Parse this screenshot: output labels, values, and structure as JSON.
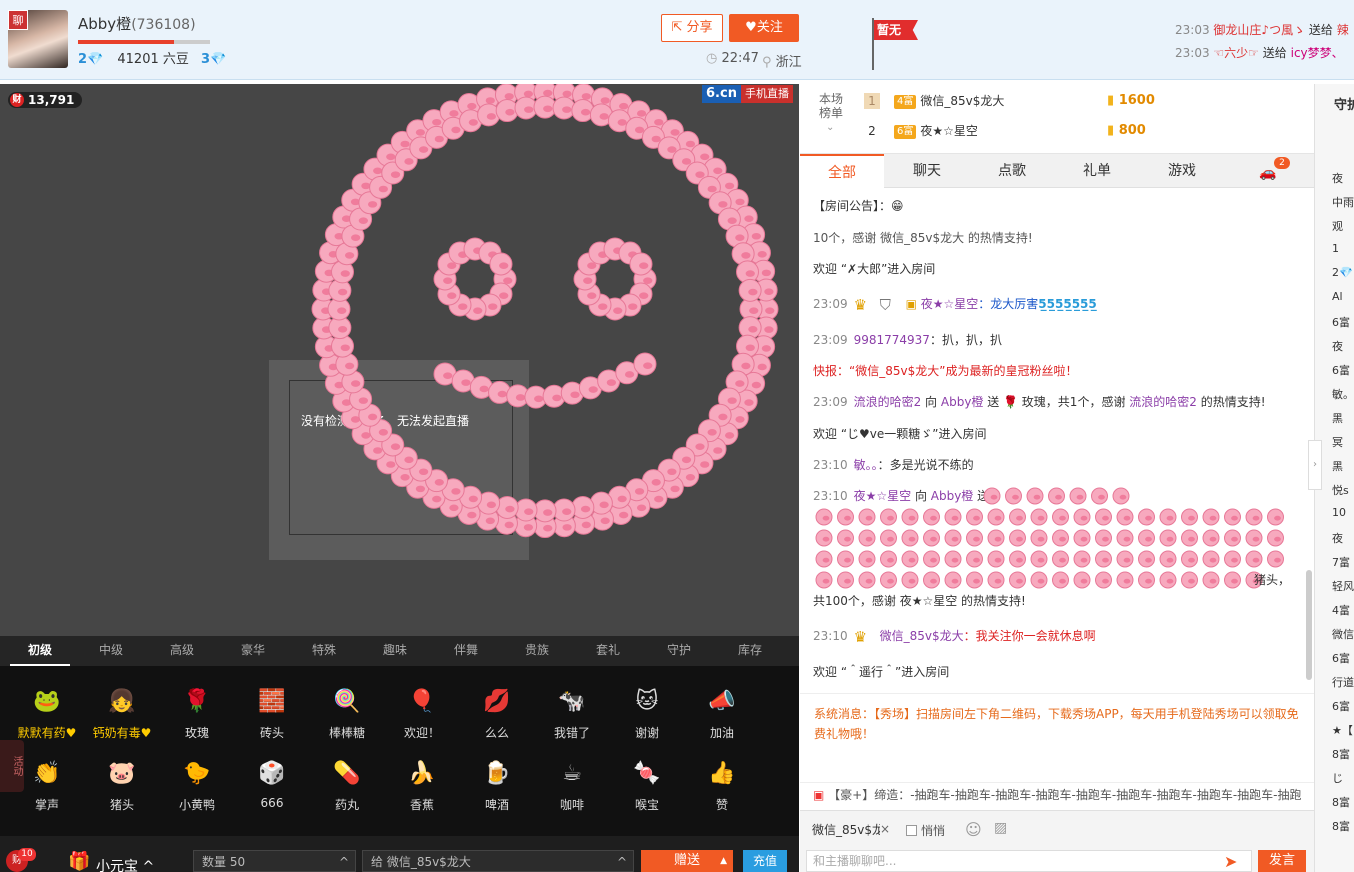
{
  "header": {
    "avatar_badge": "聊",
    "host_name": "Abby橙",
    "host_id": "(736108)",
    "fans_count": "2",
    "beans": "41201 六豆",
    "gems": "3",
    "share_label": "分享",
    "follow_label": "关注",
    "time": "22:47",
    "location": "浙江",
    "flag_label": "暂无",
    "gift_feed": [
      {
        "time": "23:03",
        "from": "御龙山庄♪つ風ゝ",
        "action": "送给",
        "to": "辣"
      },
      {
        "time": "23:03",
        "from": "☜六少☞",
        "action": "送给",
        "to": "icy梦梦、"
      }
    ]
  },
  "video": {
    "viewers": "13,791",
    "viewer_icon": "财",
    "logo": "6.cn",
    "mobile_live": "手机直播",
    "no_video_message": "没有检测到服务，无法发起直播"
  },
  "gift_tabs": [
    "初级",
    "中级",
    "高级",
    "豪华",
    "特殊",
    "趣味",
    "伴舞",
    "贵族",
    "套礼",
    "守护",
    "库存"
  ],
  "gifts_row1": [
    {
      "label": "默默有药♥",
      "icon": "🐸",
      "hot": true
    },
    {
      "label": "钙奶有毒♥",
      "icon": "👧",
      "hot": true
    },
    {
      "label": "玫瑰",
      "icon": "🌹"
    },
    {
      "label": "砖头",
      "icon": "🧱"
    },
    {
      "label": "棒棒糖",
      "icon": "🍭"
    },
    {
      "label": "欢迎！",
      "icon": "🎈"
    },
    {
      "label": "么么",
      "icon": "💋"
    },
    {
      "label": "我错了",
      "icon": "🐄"
    },
    {
      "label": "谢谢",
      "icon": "🐱"
    },
    {
      "label": "加油",
      "icon": "📣"
    }
  ],
  "gifts_row2": [
    {
      "label": "掌声",
      "icon": "👏"
    },
    {
      "label": "猪头",
      "icon": "🐷"
    },
    {
      "label": "小黄鸭",
      "icon": "🐤"
    },
    {
      "label": "666",
      "icon": "🎲"
    },
    {
      "label": "药丸",
      "icon": "💊"
    },
    {
      "label": "香蕉",
      "icon": "🍌"
    },
    {
      "label": "啤酒",
      "icon": "🍺"
    },
    {
      "label": "咖啡",
      "icon": "☕"
    },
    {
      "label": "喉宝",
      "icon": "🍬"
    },
    {
      "label": "赞",
      "icon": "👍"
    }
  ],
  "bottom": {
    "wealth_icon": "财",
    "wealth_badge": "10",
    "treasure_label": "小元宝 ^",
    "quantity_label": "数量  50",
    "to_label": "给  微信_85v$龙大",
    "send_gift_label": "赠送",
    "recharge_label": "充值",
    "side_tab": "活动"
  },
  "rank": {
    "label": "本场榜单",
    "rows": [
      {
        "num": "1",
        "level": "4富",
        "name": "微信_85v$龙大",
        "coins": "1600"
      },
      {
        "num": "2",
        "level": "6富",
        "name": "夜★☆星空",
        "coins": "800"
      }
    ]
  },
  "chat_tabs": [
    "全部",
    "聊天",
    "点歌",
    "礼单",
    "游戏"
  ],
  "car_badge": "2",
  "chat": {
    "announcement": "【房间公告】：😁",
    "line_partial": "10个，感谢 微信_85v$龙大 的热情支持!",
    "welcome1": "欢迎 “✗大郎”进入房间",
    "m1_time": "23:09",
    "m1_name": "夜★☆星空",
    "m1_text": "：龙大厉害",
    "m1_tail": "5̲5̲5̲5̲5̲5̲5̲",
    "m2_time": "23:09",
    "m2_name": "9981774937",
    "m2_text": "：扒，扒，扒",
    "flash": "快报：“微信_85v$龙大”成为最新的皇冠粉丝啦！",
    "m3_time": "23:09",
    "m3_from": "流浪的哈密2",
    "m3_to_pre": " 向 ",
    "m3_to": "Abby橙",
    "m3_send": " 送 🌹 玫瑰，共1个，感谢 ",
    "m3_thanks": "流浪的哈密2",
    "m3_end": " 的热情支持!",
    "welcome2": "欢迎 “じ♥ve一颗糖ゞ”进入房间",
    "m4_time": "23:10",
    "m4_name": "敏。。",
    "m4_text": "：多是光说不练的",
    "m5_time": "23:10",
    "m5_name": "夜★☆星空",
    "m5_to": "Abby橙",
    "m5_tail": "猪头，",
    "m5_end": "共100个，感谢 夜★☆星空 的热情支持!",
    "m6_time": "23:10",
    "m6_name": "微信_85v$龙大",
    "m6_text": "：我关注你一会就休息啊",
    "welcome3": "欢迎 “＾遥行＾”进入房间"
  },
  "system_msg": "系统消息：【秀场】扫描房间左下角二维码，下载秀场APP，每天用手机登陆秀场可以领取免费礼物哦！",
  "car_strip": "【豪+】缔造：-抽跑车-抽跑车-抽跑车-抽跑车-抽跑车-抽跑车-抽跑车-抽跑车-抽跑车-抽跑",
  "chat_input": {
    "to_name": "微信_85v$龙大",
    "whisper_label": "悄悄",
    "placeholder": "和主播聊聊吧...",
    "send_label": "发言"
  },
  "right_panel": {
    "title": "守护",
    "items": [
      "夜",
      "中雨",
      "观",
      "1",
      "2💎",
      "Al",
      "6富",
      "夜",
      "6富",
      "敏。",
      "黑",
      "冥",
      "黑",
      "悦s",
      "10",
      "夜",
      "7富",
      "轻风",
      "4富",
      "微信",
      "6富",
      "行道",
      "6富",
      "★【",
      "8富",
      "じ",
      "8富",
      "8富"
    ]
  }
}
